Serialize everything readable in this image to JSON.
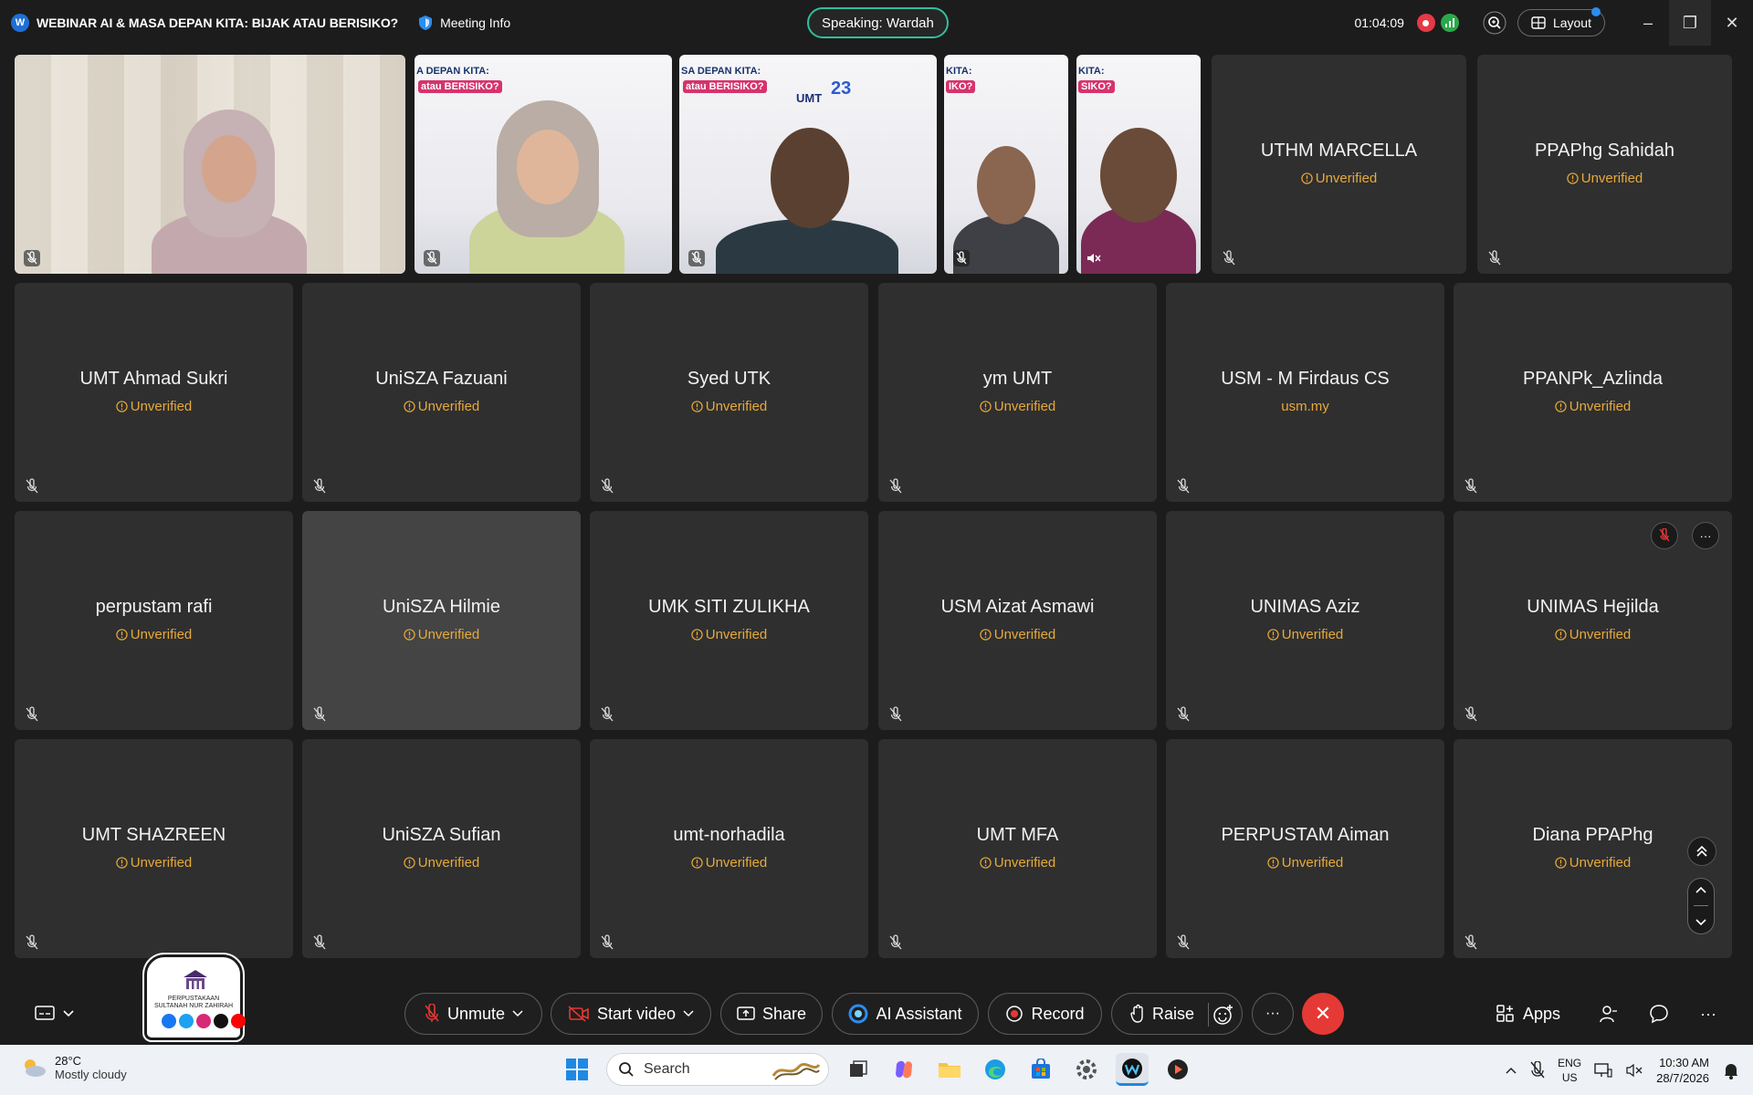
{
  "titlebar": {
    "meeting_title": "WEBINAR AI & MASA DEPAN KITA: BIJAK ATAU BERISIKO?",
    "meeting_info": "Meeting Info",
    "speaking": "Speaking: Wardah",
    "timer": "01:04:09",
    "layout_label": "Layout"
  },
  "banner": {
    "text_a": "A DEPAN KITA:",
    "text_b": "atau BERISIKO?",
    "text_c": "SA DEPAN KITA:",
    "text_d": "atau BERISIKO?",
    "text_e": "KITA:",
    "text_f": "IKO?",
    "text_g": "KITA:",
    "text_h": "SIKO?",
    "logo": "UMT",
    "num": "23"
  },
  "participants": [
    {
      "name": "UTHM MARCELLA",
      "status": "Unverified"
    },
    {
      "name": "PPAPhg Sahidah",
      "status": "Unverified"
    },
    {
      "name": "UMT Ahmad Sukri",
      "status": "Unverified"
    },
    {
      "name": "UniSZA Fazuani",
      "status": "Unverified"
    },
    {
      "name": "Syed UTK",
      "status": "Unverified"
    },
    {
      "name": "ym UMT",
      "status": "Unverified"
    },
    {
      "name": "USM - M Firdaus CS",
      "status": "usm.my"
    },
    {
      "name": "PPANPk_Azlinda",
      "status": "Unverified"
    },
    {
      "name": "perpustam rafi",
      "status": "Unverified"
    },
    {
      "name": "UniSZA Hilmie",
      "status": "Unverified"
    },
    {
      "name": "UMK SITI ZULIKHA",
      "status": "Unverified"
    },
    {
      "name": "USM Aizat Asmawi",
      "status": "Unverified"
    },
    {
      "name": "UNIMAS Aziz",
      "status": "Unverified"
    },
    {
      "name": "UNIMAS Hejilda",
      "status": "Unverified"
    },
    {
      "name": "UMT SHAZREEN",
      "status": "Unverified"
    },
    {
      "name": "UniSZA Sufian",
      "status": "Unverified"
    },
    {
      "name": "umt-norhadila",
      "status": "Unverified"
    },
    {
      "name": "UMT MFA",
      "status": "Unverified"
    },
    {
      "name": "PERPUSTAM Aiman",
      "status": "Unverified"
    },
    {
      "name": "Diana PPAPhg",
      "status": "Unverified"
    }
  ],
  "toolbar": {
    "unmute": "Unmute",
    "start_video": "Start video",
    "share": "Share",
    "ai_assistant": "AI Assistant",
    "record": "Record",
    "raise": "Raise",
    "apps": "Apps"
  },
  "logo_badge": {
    "line1": "PERPUSTAKAAN",
    "line2": "SULTANAH NUR ZAHIRAH"
  },
  "taskbar": {
    "temp": "28°C",
    "weather": "Mostly cloudy",
    "search": "Search",
    "lang1": "ENG",
    "lang2": "US",
    "time": "10:30 AM",
    "date": "28/7/2026"
  },
  "colors": {
    "unverified": "#e7a93a",
    "speaking_border": "#2fbf9f",
    "end_call": "#e53935",
    "tile": "#2f2f2f"
  }
}
